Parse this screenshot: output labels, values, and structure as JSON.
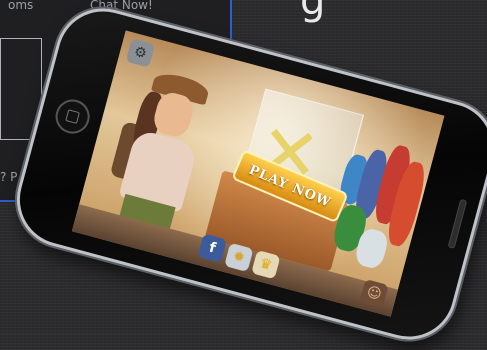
{
  "background": {
    "panel_text_top_left": "oms",
    "panel_text_top_right": "Chat Now!",
    "panel_text_bottom": "? P",
    "heading_fragment": "g"
  },
  "game": {
    "play_label": "PLAY NOW",
    "facebook_label": "f"
  },
  "icons": [
    "gear-icon",
    "facebook-icon",
    "medal-icon",
    "trophy-icon",
    "character-icon"
  ],
  "colors": {
    "accent_blue": "#2d5fd0",
    "play_button": "#f2b531"
  }
}
